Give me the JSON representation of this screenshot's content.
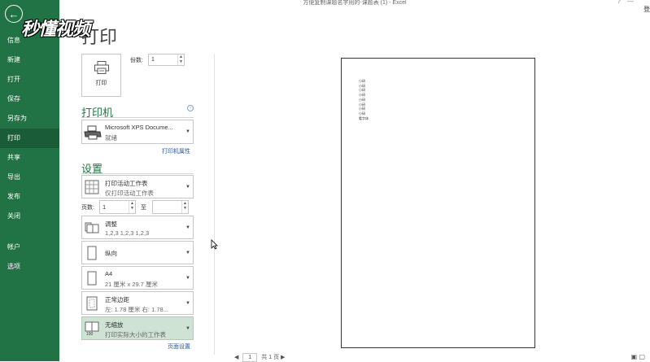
{
  "window": {
    "title": "方便复制课题名字用的-课题表 (1) - Excel",
    "help": "?",
    "minimize": "—",
    "signin": "登"
  },
  "watermark": "秒懂视频",
  "sidebar": {
    "back_icon": "←",
    "items": [
      {
        "label": "信息"
      },
      {
        "label": "新建"
      },
      {
        "label": "打开"
      },
      {
        "label": "保存"
      },
      {
        "label": "另存为"
      },
      {
        "label": "打印"
      },
      {
        "label": "共享"
      },
      {
        "label": "导出"
      },
      {
        "label": "发布"
      },
      {
        "label": "关闭"
      },
      {
        "label": "帐户"
      },
      {
        "label": "选项"
      }
    ],
    "active": "打印"
  },
  "main": {
    "heading": "打印",
    "print_button": "打印",
    "copies_label": "份数:",
    "copies_value": "1",
    "printer_heading": "打印机",
    "printer_name": "Microsoft XPS Docume...",
    "printer_status": "就绪",
    "printer_properties": "打印机属性",
    "settings_heading": "设置",
    "settings": [
      {
        "line1": "打印活动工作表",
        "line2": "仅打印活动工作表",
        "icon": "sheet-icon"
      },
      {
        "line1": "调整",
        "line2": "1,2,3    1,2,3    1,2,3",
        "icon": "collate-icon"
      },
      {
        "line1": "纵向",
        "line2": "",
        "icon": "portrait-icon"
      },
      {
        "line1": "A4",
        "line2": "21 厘米 x 29.7 厘米",
        "icon": "paper-icon"
      },
      {
        "line1": "正常边距",
        "line2": "左: 1.78 厘米    右: 1.78...",
        "icon": "margins-icon"
      },
      {
        "line1": "无缩放",
        "line2": "打印实际大小的工作表",
        "icon": "scaling-icon"
      }
    ],
    "pages_label": "页数:",
    "pages_from": "1",
    "pages_to_label": "至",
    "pages_to": "",
    "page_setup": "页面设置"
  },
  "preview": {
    "lines": [
      "小研",
      "小研",
      "小研",
      "小研",
      "小研",
      "小研",
      "小研",
      "小研",
      "看字体"
    ],
    "page_current": "1",
    "page_total": "共 1 页",
    "prev": "◀",
    "next": "▶"
  },
  "colors": {
    "accent": "#217346",
    "selected_bg": "#cee3d4",
    "link": "#2a5699"
  }
}
